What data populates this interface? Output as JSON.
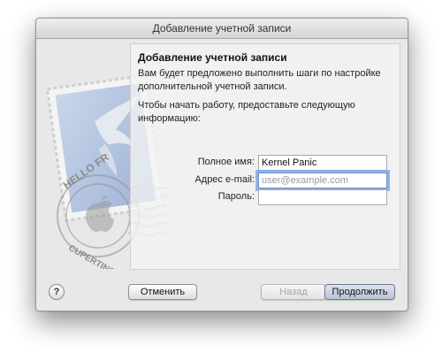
{
  "window": {
    "title": "Добавление учетной записи"
  },
  "panel": {
    "heading": "Добавление учетной записи",
    "paragraph1": "Вам будет предложено выполнить шаги по настройке дополнительной учетной записи.",
    "paragraph2": "Чтобы начать работу, предоставьте следующую информацию:"
  },
  "form": {
    "name_label": "Полное имя:",
    "name_value": "Kernel Panic",
    "email_label": "Адрес e-mail:",
    "email_placeholder": "user@example.com",
    "password_label": "Пароль:"
  },
  "stamp": {
    "text_top": "HELLO FR",
    "text_bottom": "CUPERTINO"
  },
  "buttons": {
    "help": "?",
    "cancel": "Отменить",
    "back": "Назад",
    "continue": "Продолжить"
  }
}
